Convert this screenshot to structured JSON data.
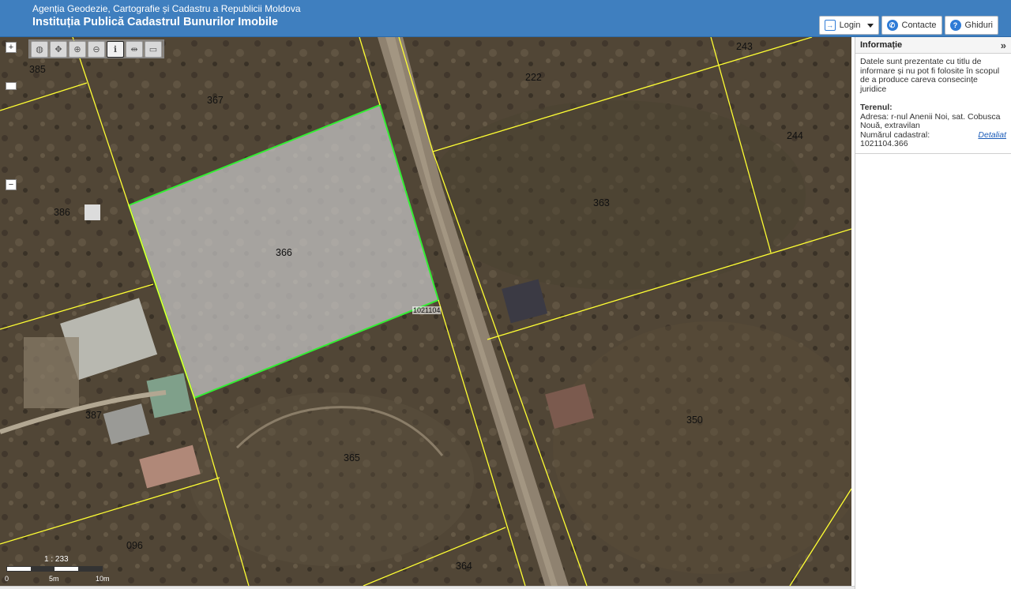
{
  "header": {
    "agency": "Agenția Geodezie, Cartografie și Cadastru a Republicii Moldova",
    "institution": "Instituția Publică Cadastrul Bunurilor Imobile",
    "nav": {
      "login": "Login",
      "contacts": "Contacte",
      "guides": "Ghiduri"
    }
  },
  "map": {
    "parcels": {
      "p385": "385",
      "p367": "367",
      "p222": "222",
      "p243": "243",
      "p244": "244",
      "p386": "386",
      "p363": "363",
      "p366": "366",
      "p387": "387",
      "p365": "365",
      "p350": "350",
      "p096": "096",
      "p364": "364"
    },
    "cadastral_code": "1021104",
    "zoom_in": "+",
    "zoom_out": "−",
    "scale": {
      "ratio": "1 : 233",
      "tick0": "0",
      "tick5": "5m",
      "tick10": "10m"
    },
    "colors": {
      "parcel_line": "#ffff33",
      "selected_outline": "#33ee33"
    }
  },
  "panel": {
    "title": "Informație",
    "disclaimer": "Datele sunt prezentate cu titlu de informare și nu pot fi folosite în scopul de a produce careva consecințe juridice",
    "land_title": "Terenul:",
    "address": "Adresa: r-nul Anenii Noi, sat. Cobusca Nouă, extravilan",
    "cadastral_number": "Numărul cadastral: 1021104.366",
    "details_link": "Detaliat"
  }
}
